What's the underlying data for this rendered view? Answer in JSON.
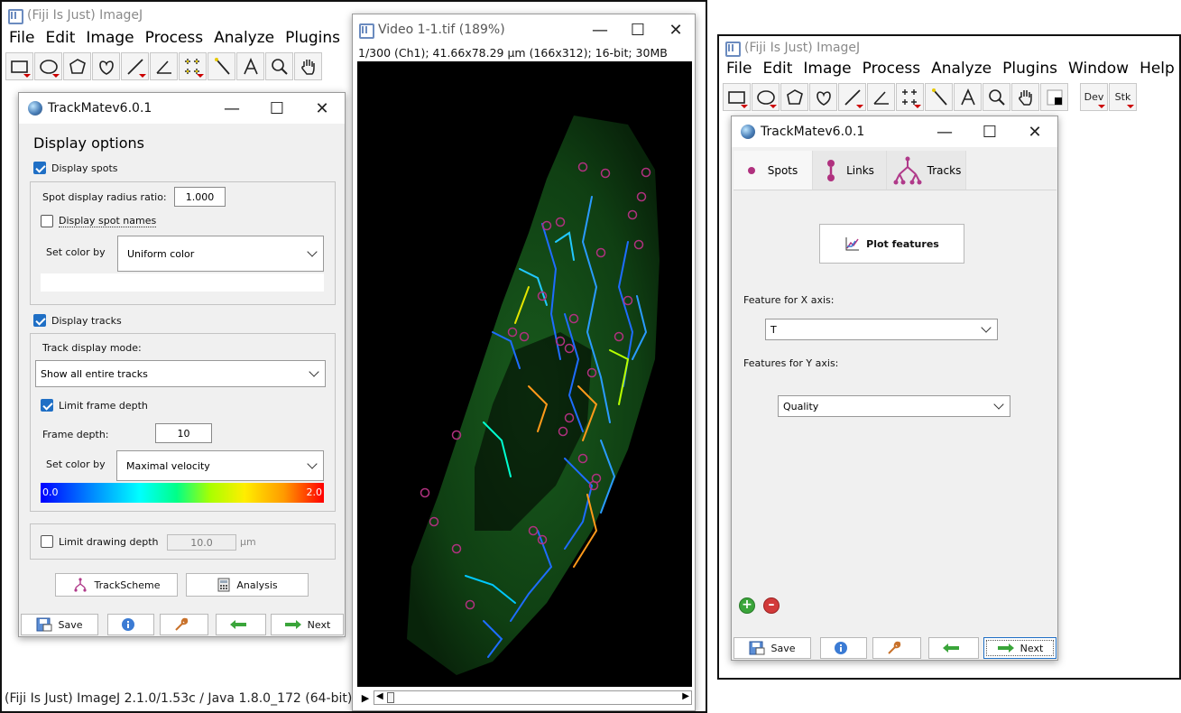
{
  "left_window": {
    "imagej_title": "(Fiji Is Just) ImageJ",
    "menu": [
      "File",
      "Edit",
      "Image",
      "Process",
      "Analyze",
      "Plugins"
    ],
    "status_bar": "(Fiji Is Just) ImageJ 2.1.0/1.53c / Java 1.8.0_172 (64-bit)"
  },
  "trackmate_left": {
    "title": "TrackMatev6.0.1",
    "section_title": "Display options",
    "display_spots_label": "Display spots",
    "spot_radius_label": "Spot display radius ratio:",
    "spot_radius_value": "1.000",
    "display_spot_names_label": "Display spot names",
    "set_color_by_label": "Set color by",
    "spot_color_value": "Uniform color",
    "display_tracks_label": "Display tracks",
    "track_display_mode_label": "Track display mode:",
    "track_display_mode_value": "Show all entire tracks",
    "limit_frame_depth_label": "Limit frame depth",
    "frame_depth_label": "Frame depth:",
    "frame_depth_value": "10",
    "track_color_label": "Set color by",
    "track_color_value": "Maximal velocity",
    "colorbar_min": "0.0",
    "colorbar_max": "2.0",
    "limit_drawing_depth_label": "Limit drawing depth",
    "drawing_depth_value": "10.0",
    "drawing_depth_unit": "µm",
    "trackscheme_label": "TrackScheme",
    "analysis_label": "Analysis",
    "save_label": "Save",
    "next_label": "Next"
  },
  "video_window": {
    "title": "Video 1-1.tif (189%)",
    "info": "1/300 (Ch1); 41.66x78.29 µm (166x312); 16-bit; 30MB"
  },
  "right_window": {
    "imagej_title": "(Fiji Is Just) ImageJ",
    "menu": [
      "File",
      "Edit",
      "Image",
      "Process",
      "Analyze",
      "Plugins",
      "Window",
      "Help"
    ],
    "dev_label": "Dev",
    "stk_label": "Stk"
  },
  "trackmate_right": {
    "title": "TrackMatev6.0.1",
    "tabs": [
      "Spots",
      "Links",
      "Tracks"
    ],
    "plot_features_label": "Plot features",
    "x_axis_label": "Feature for X axis:",
    "x_axis_value": "T",
    "y_axis_label": "Features for Y axis:",
    "y_axis_value": "Quality",
    "save_label": "Save",
    "next_label": "Next"
  },
  "colors": {
    "accent_blue": "#1f6fc5",
    "spot_magenta": "#b0317f",
    "track_magenta": "#b03a8a",
    "next_green": "#3aa53a"
  }
}
